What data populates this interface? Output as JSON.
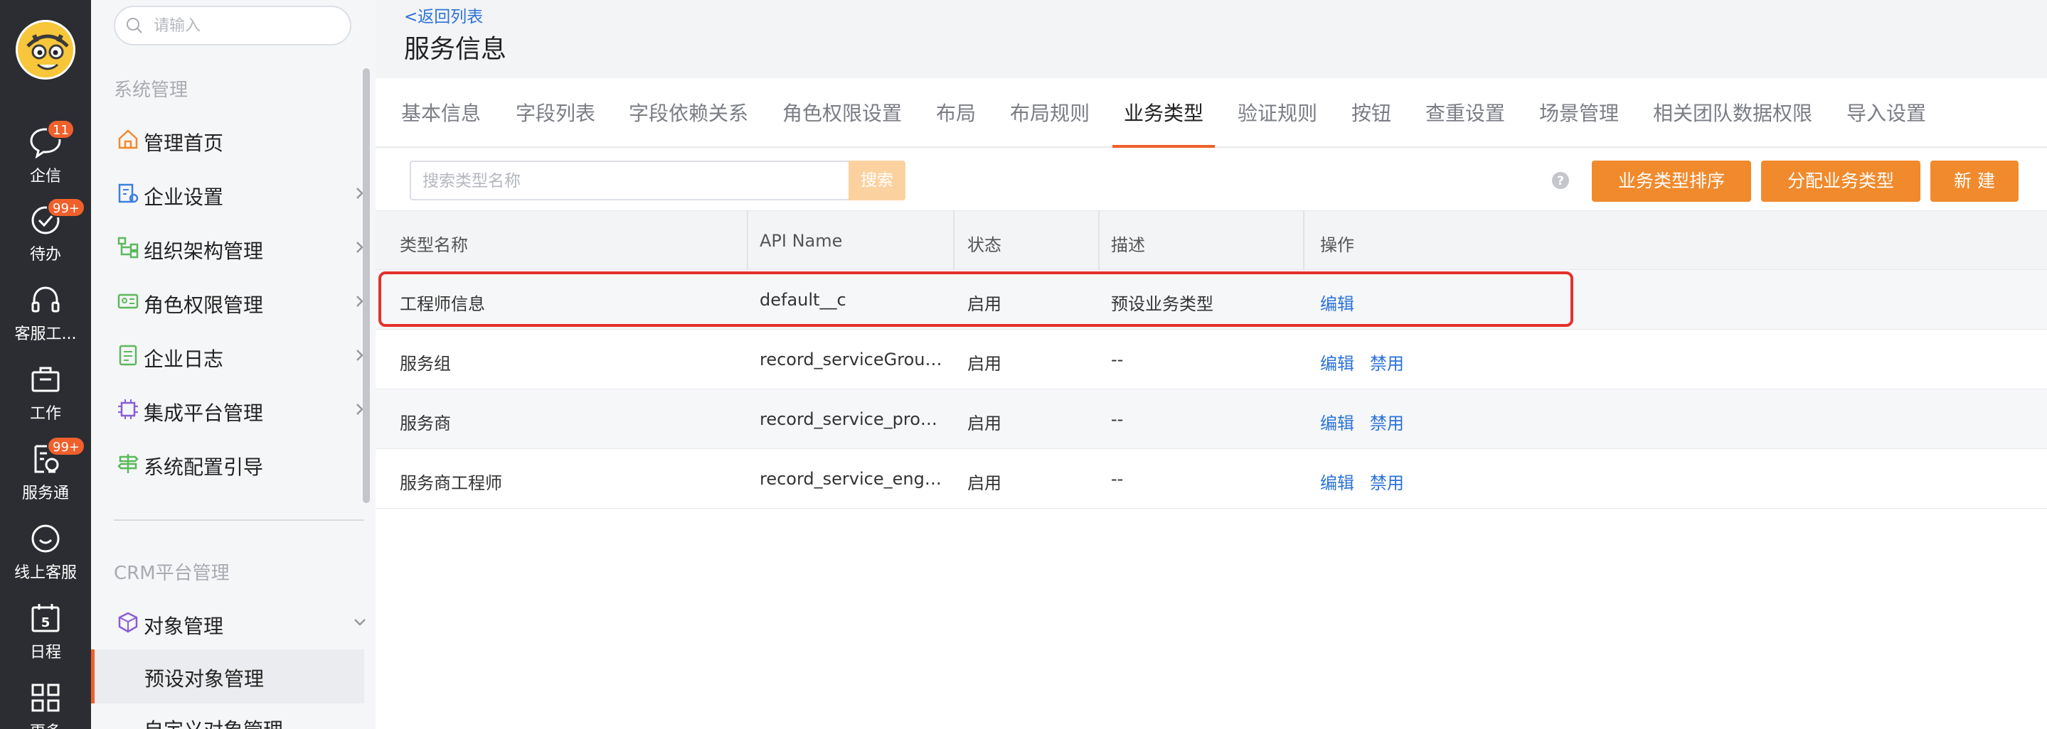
{
  "rail": {
    "items": [
      {
        "label": "企信",
        "icon": "chat-icon",
        "badge": "11"
      },
      {
        "label": "待办",
        "icon": "check-circle-icon",
        "badge": "99+"
      },
      {
        "label": "客服工...",
        "icon": "headset-icon",
        "badge": ""
      },
      {
        "label": "工作",
        "icon": "briefcase-icon",
        "badge": ""
      },
      {
        "label": "服务通",
        "icon": "service-doc-icon",
        "badge": "99+"
      },
      {
        "label": "线上客服",
        "icon": "smile-chat-icon",
        "badge": ""
      },
      {
        "label": "日程",
        "icon": "calendar-icon",
        "badge": "",
        "day": "5"
      },
      {
        "label": "更多",
        "icon": "grid-icon",
        "badge": ""
      }
    ]
  },
  "sidebar": {
    "search_placeholder": "请输入",
    "section1": "系统管理",
    "items": [
      {
        "label": "管理首页",
        "icon": "home-icon",
        "chevron": false
      },
      {
        "label": "企业设置",
        "icon": "enterprise-settings-icon",
        "chevron": true
      },
      {
        "label": "组织架构管理",
        "icon": "org-chart-icon",
        "chevron": true
      },
      {
        "label": "角色权限管理",
        "icon": "id-card-icon",
        "chevron": true
      },
      {
        "label": "企业日志",
        "icon": "log-icon",
        "chevron": true
      },
      {
        "label": "集成平台管理",
        "icon": "chip-icon",
        "chevron": true
      },
      {
        "label": "系统配置引导",
        "icon": "signpost-icon",
        "chevron": false
      }
    ],
    "section2": "CRM平台管理",
    "object_mgmt": {
      "label": "对象管理",
      "icon": "object-cube-icon"
    },
    "sub_items": [
      "预设对象管理",
      "自定义对象管理"
    ]
  },
  "header": {
    "back_link": "<返回列表",
    "title": "服务信息"
  },
  "tabs": [
    "基本信息",
    "字段列表",
    "字段依赖关系",
    "角色权限设置",
    "布局",
    "布局规则",
    "业务类型",
    "验证规则",
    "按钮",
    "查重设置",
    "场景管理",
    "相关团队数据权限",
    "导入设置"
  ],
  "active_tab": "业务类型",
  "toolbar": {
    "search_placeholder": "搜索类型名称",
    "search_button": "搜索",
    "sort_button": "业务类型排序",
    "assign_button": "分配业务类型",
    "new_button": "新 建"
  },
  "table": {
    "columns": [
      "类型名称",
      "API Name",
      "状态",
      "描述",
      "操作"
    ],
    "rows": [
      {
        "name": "工程师信息",
        "api": "default__c",
        "status": "启用",
        "desc": "预设业务类型",
        "actions": [
          "编辑"
        ]
      },
      {
        "name": "服务组",
        "api": "record_serviceGroup…",
        "status": "启用",
        "desc": "--",
        "actions": [
          "编辑",
          "禁用"
        ]
      },
      {
        "name": "服务商",
        "api": "record_service_provi…",
        "status": "启用",
        "desc": "--",
        "actions": [
          "编辑",
          "禁用"
        ]
      },
      {
        "name": "服务商工程师",
        "api": "record_service_engin…",
        "status": "启用",
        "desc": "--",
        "actions": [
          "编辑",
          "禁用"
        ]
      }
    ]
  },
  "colors": {
    "rail_bg": "#2b2d33",
    "accent_orange": "#f08a2c",
    "active_underline": "#f0602b",
    "link_blue": "#2c73d9",
    "badge": "#f0602b",
    "highlight_border": "#e5312b"
  }
}
